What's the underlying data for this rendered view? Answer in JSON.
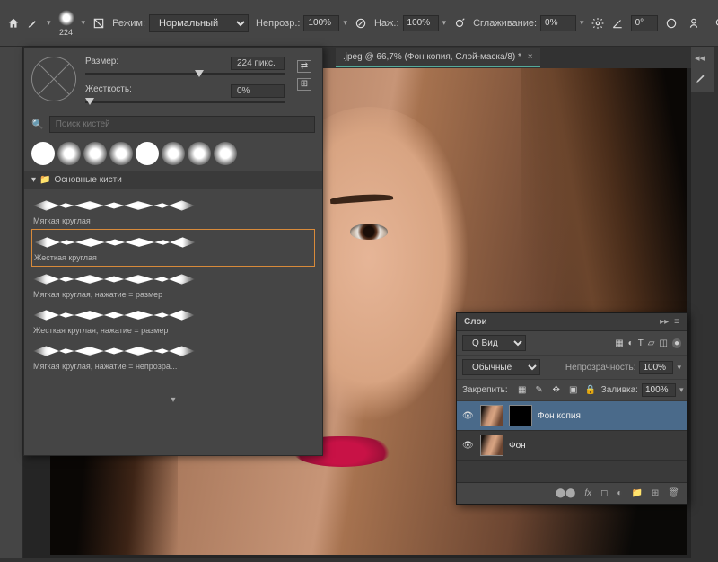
{
  "topbar": {
    "brush_size": "224",
    "mode_label": "Режим:",
    "mode_value": "Нормальный",
    "opacity_label": "Непрозр.:",
    "opacity_value": "100%",
    "flow_label": "Наж.:",
    "flow_value": "100%",
    "smoothing_label": "Сглаживание:",
    "smoothing_value": "0%",
    "angle_value": "0°"
  },
  "tab": {
    "label": ".jpeg @ 66,7% (Фон копия, Слой-маска/8) *"
  },
  "brush_panel": {
    "size_label": "Размер:",
    "size_value": "224 пикс.",
    "hardness_label": "Жесткость:",
    "hardness_value": "0%",
    "search_placeholder": "Поиск кистей",
    "folder_name": "Основные кисти",
    "brushes": [
      "Мягкая круглая",
      "Жесткая круглая",
      "Мягкая круглая, нажатие = размер",
      "Жесткая круглая, нажатие = размер",
      "Мягкая круглая, нажатие = непрозра..."
    ]
  },
  "layers": {
    "title": "Слои",
    "type_label": "Q Вид",
    "blend_mode": "Обычные",
    "opacity_label": "Непрозрачность:",
    "opacity_value": "100%",
    "lock_label": "Закрепить:",
    "fill_label": "Заливка:",
    "fill_value": "100%",
    "items": [
      {
        "name": "Фон копия",
        "has_mask": true
      },
      {
        "name": "Фон",
        "has_mask": false
      }
    ]
  }
}
